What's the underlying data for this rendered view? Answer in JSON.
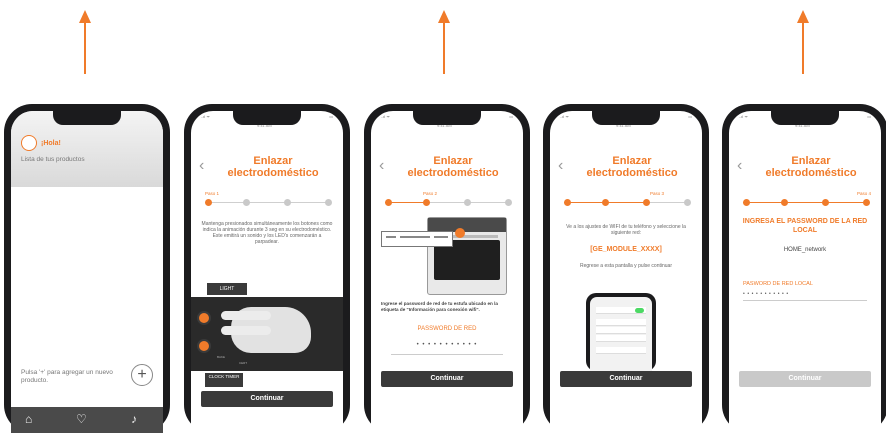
{
  "colors": {
    "accent": "#f07b2a",
    "dark_button": "#3a3a3a",
    "disabled_button": "#c9c9c9"
  },
  "phone1": {
    "greeting": "¡Hola!",
    "subtitle": "Lista de tus productos",
    "hint": "Pulsa '+' para agregar un nuevo producto.",
    "add_icon": "plus-icon",
    "nav": [
      "home-icon",
      "heart-icon",
      "bell-icon"
    ]
  },
  "phone2": {
    "time": "9:41 AM",
    "title": "Enlazar electrodoméstico",
    "step_label": "Paso 1",
    "instructions": "Mantenga presionados simultáneamente los botones como indica la animación durante 3 seg en su electrodoméstico. Este emitirá un sonido y los LED's comenzarán a parpadear.",
    "light_label": "LIGHT",
    "clock_label": "CLOCK TIMER",
    "continue": "Continuar"
  },
  "phone3": {
    "time": "9:41 AM",
    "title": "Enlazar electrodoméstico",
    "step_label": "Paso 2",
    "instructions": "Ingrese el password de red de tu estufa ubicado en la etiqueta de \"Información para conexión wifi\".",
    "password_label": "PASSWORD DE RED",
    "password_mask": "• • • • • • • • • • •",
    "continue": "Continuar"
  },
  "phone4": {
    "time": "9:41 AM",
    "title": "Enlazar electrodoméstico",
    "step_label": "Paso 3",
    "instructions": "Ve a los ajustes de WIFI de tu teléfono y seleccione la siguiente red:",
    "module": "[GE_MODULE_XXXX]",
    "return_text": "Regrese a esta pantalla y pulse continuar",
    "continue": "Continuar"
  },
  "phone5": {
    "time": "9:41 AM",
    "title": "Enlazar electrodoméstico",
    "step_label": "Paso 4",
    "heading": "INGRESA EL PASSWORD DE LA RED LOCAL",
    "network": "HOME_network",
    "password_label": "PASWORD DE RED LOCAL",
    "password_mask": "• • • • • • • • • • •",
    "continue": "Continuar"
  }
}
